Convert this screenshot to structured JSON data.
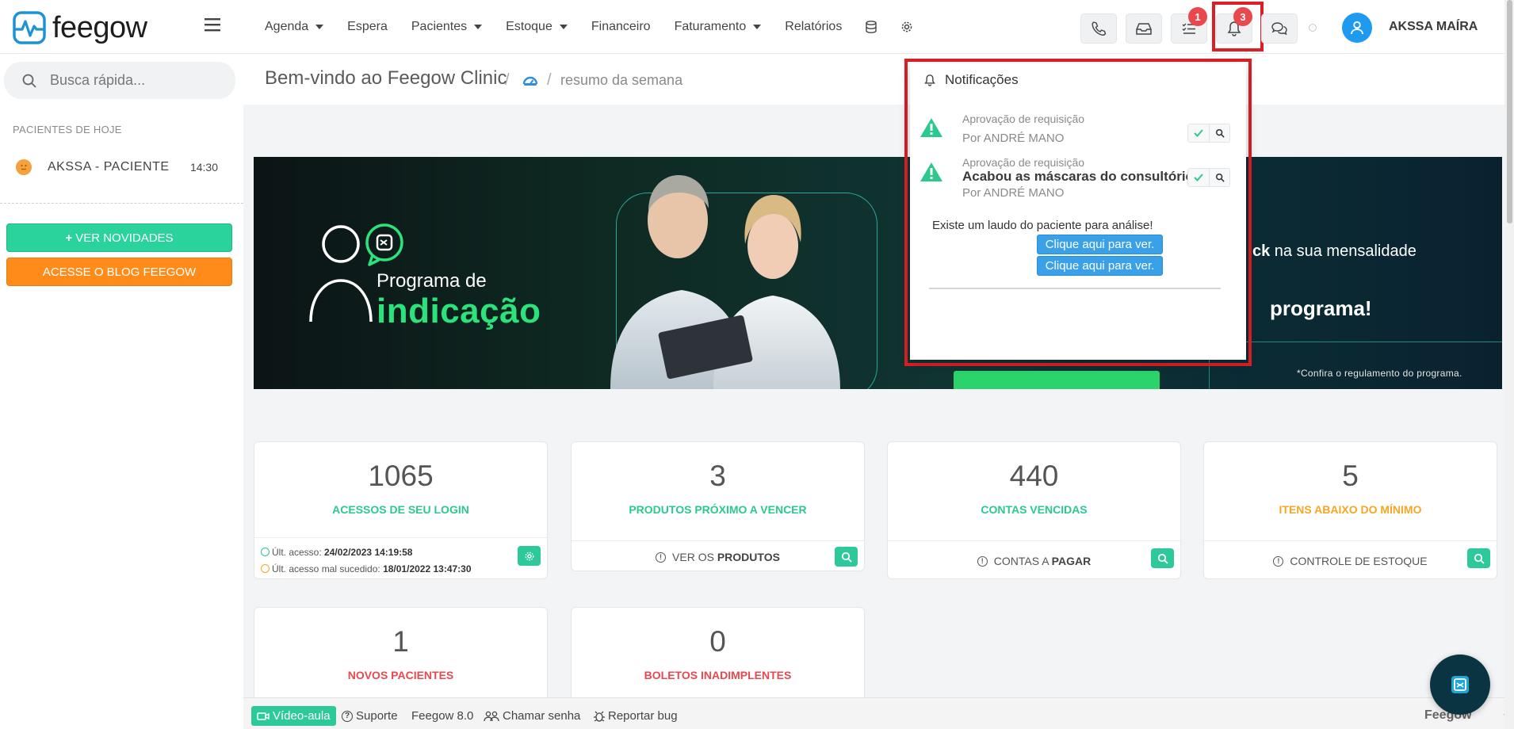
{
  "app": {
    "logo_text": "feegow"
  },
  "nav": {
    "items": [
      {
        "label": "Agenda",
        "dropdown": true
      },
      {
        "label": "Espera",
        "dropdown": false
      },
      {
        "label": "Pacientes",
        "dropdown": true
      },
      {
        "label": "Estoque",
        "dropdown": true
      },
      {
        "label": "Financeiro",
        "dropdown": false
      },
      {
        "label": "Faturamento",
        "dropdown": true
      },
      {
        "label": "Relatórios",
        "dropdown": false
      }
    ]
  },
  "toolbar": {
    "tasks_badge": "1",
    "notifications_badge": "3",
    "user_name": "AKSSA MAÍRA"
  },
  "sidebar": {
    "search_placeholder": "Busca rápida...",
    "today_title": "PACIENTES DE HOJE",
    "patient_name": "AKSSA - PACIENTE",
    "patient_time": "14:30",
    "btn_novidades": "VER NOVIDADES",
    "btn_blog": "ACESSE O BLOG FEEGOW"
  },
  "breadcrumb": {
    "title": "Bem-vindo ao Feegow Clinic",
    "separator": "/",
    "current": "resumo da semana"
  },
  "banner": {
    "program_line": "Programa de",
    "indicacao": "indicação",
    "cash_bold": "ck",
    "cash_rest": " na sua mensalidade",
    "programa": "programa!",
    "terms": "*Confira o regulamento do programa."
  },
  "cards": [
    {
      "value": "1065",
      "label": "ACESSOS DE SEU LOGIN",
      "label_color": "#2bc98e"
    },
    {
      "value": "3",
      "label": "PRODUTOS PRÓXIMO A VENCER",
      "label_color": "#2bc98e",
      "foot_prefix": "VER OS ",
      "foot_bold": "PRODUTOS"
    },
    {
      "value": "440",
      "label": "CONTAS VENCIDAS",
      "label_color": "#2bc98e",
      "foot_prefix": "CONTAS A ",
      "foot_bold": "PAGAR"
    },
    {
      "value": "5",
      "label": "ITENS ABAIXO DO MÍNIMO",
      "label_color": "#f5a623",
      "foot_prefix": "CONTROLE DE ESTOQUE",
      "foot_bold": ""
    },
    {
      "value": "1",
      "label": "NOVOS PACIENTES",
      "label_color": "#e8484e"
    },
    {
      "value": "0",
      "label": "BOLETOS INADIMPLENTES",
      "label_color": "#e8484e"
    }
  ],
  "login_info": {
    "last_access_label": "Últ. acesso:",
    "last_access_value": "24/02/2023 14:19:58",
    "last_fail_label": "Últ. acesso mal sucedido:",
    "last_fail_value": "18/01/2022 13:47:30"
  },
  "notifications": {
    "title": "Notificações",
    "items": [
      {
        "type": "Aprovação de requisição",
        "message": "",
        "by": "Por ANDRÉ MANO"
      },
      {
        "type": "Aprovação de requisição",
        "message": "Acabou as máscaras do consultório.",
        "by": "Por ANDRÉ MANO"
      }
    ],
    "extra_text": "Existe um laudo do paciente para análise!",
    "link_1": "Clique aqui para ver.",
    "link_2": "Clique aqui para ver."
  },
  "bottombar": {
    "video": "Vídeo-aula",
    "suporte": "Suporte",
    "version": "Feegow 8.0",
    "chamar": "Chamar senha",
    "bug": "Reportar bug",
    "brand": "Feegow",
    "up": "↑"
  },
  "colors": {
    "accent_green": "#2bd39c",
    "accent_orange": "#ff8c1a",
    "badge_red": "#e8484e",
    "highlight_red": "#dc1f26",
    "primary_blue": "#1e9bf0"
  },
  "icons": [
    "menu-icon",
    "phone-icon",
    "inbox-icon",
    "tasks-icon",
    "bell-icon",
    "chat-icon",
    "user-icon",
    "search-icon",
    "database-icon",
    "gear-icon",
    "warning-icon",
    "check-icon",
    "magnify-icon",
    "info-icon",
    "video-icon",
    "help-icon",
    "users-icon",
    "bug-icon"
  ]
}
